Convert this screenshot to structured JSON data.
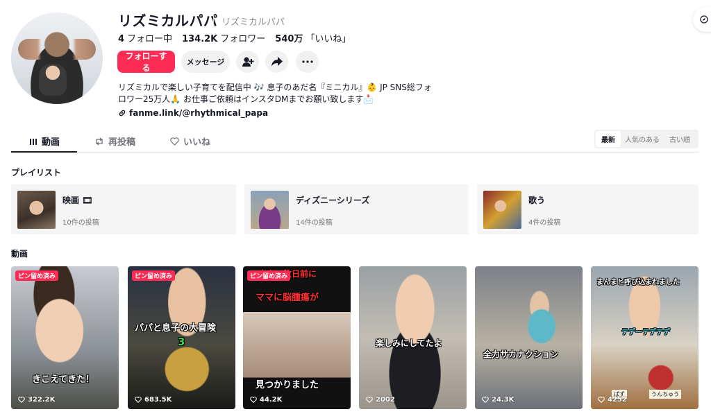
{
  "profile": {
    "display_name": "リズミカルパパ",
    "username": "リズミカルパパ",
    "stats": [
      {
        "value": "4",
        "label": "フォロー中"
      },
      {
        "value": "134.2K",
        "label": "フォロワー"
      },
      {
        "value": "540万",
        "label": "「いいね」"
      }
    ],
    "follow_label": "フォローする",
    "message_label": "メッセージ",
    "bio_line1": "リズミカルで楽しい子育てを配信中 🎶 息子のあだ名『ミニカル』👶 JP SNS総フォ",
    "bio_line2": "ロワー25万人🙏 お仕事ご依頼はインスタDMまでお願い致します📩",
    "link": "fanme.link/@rhythmical_papa"
  },
  "tabs": [
    {
      "label": "動画",
      "icon": "video-grid-icon",
      "active": true
    },
    {
      "label": "再投稿",
      "icon": "repost-icon",
      "active": false
    },
    {
      "label": "いいね",
      "icon": "heart-outline-icon",
      "active": false
    }
  ],
  "sort": {
    "options": [
      "最新",
      "人気のある",
      "古い順"
    ],
    "selected": "最新"
  },
  "playlists_title": "プレイリスト",
  "playlists": [
    {
      "title": "映画 🎞",
      "count": "10件の投稿"
    },
    {
      "title": "ディズニーシリーズ",
      "count": "14件の投稿"
    },
    {
      "title": "歌う",
      "count": "4件の投稿"
    }
  ],
  "videos_title": "動画",
  "videos": [
    {
      "badge": "ピン留め済み",
      "caption": "きこえてきた！",
      "views": "322.2K"
    },
    {
      "badge": "ピン留め済み",
      "caption": "パパと息子の大冒険",
      "caption_sub": "3",
      "views": "683.5K"
    },
    {
      "badge": "ピン留め済み",
      "caption_top1": "出産の数日前に",
      "caption_top2": "ママに脳腫瘍が",
      "caption": "見つかりました",
      "views": "44.2K"
    },
    {
      "badge": "",
      "caption": "楽しみにしてたよ",
      "views": "2002"
    },
    {
      "badge": "",
      "caption": "全力サカナクション",
      "views": "24.3K"
    },
    {
      "badge": "",
      "caption_top1": "まんまと呼び込まれました",
      "caption": "テデーテデテデ",
      "label_a": "ぱず",
      "label_b": "うんちゅう",
      "views": "4252"
    }
  ]
}
